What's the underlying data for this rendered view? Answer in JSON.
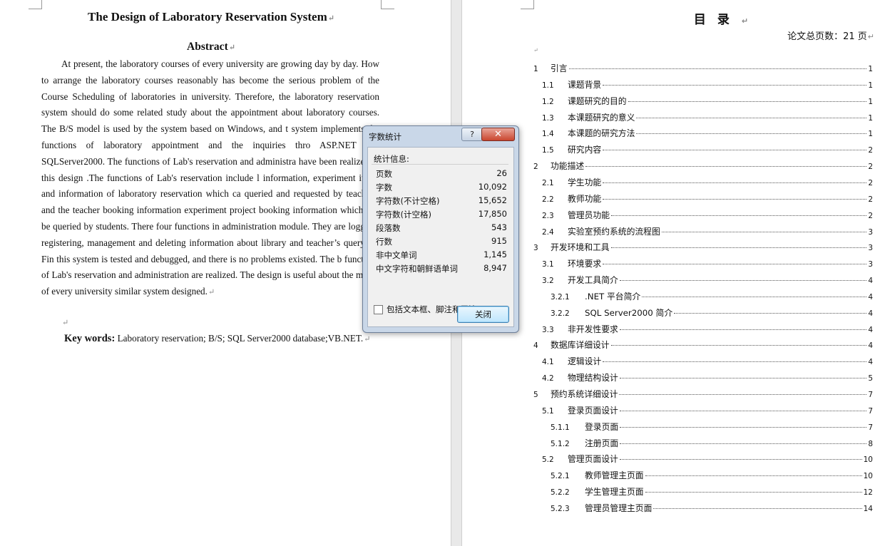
{
  "left_page": {
    "title": "The Design of Laboratory Reservation System",
    "abstract_heading": "Abstract",
    "abstract_lines": [
      "At present, the laboratory courses of every university are growing day by day.",
      "How to arrange the laboratory courses reasonably has become the serious problem of",
      "the Course Scheduling of laboratories in university. Therefore, the laboratory",
      "reservation system should do some related study about the appointment about",
      "laboratory courses. The B/S model is used by the system based on Windows, and t",
      "system implements the functions of laboratory appointment and the inquiries thro",
      "ASP.NET and SQLServer2000. The functions of Lab's reservation and administra",
      "have been realized in this design .The functions of Lab's reservation include l",
      "information, experiment items and information of laboratory reservation which ca",
      "queried and requested by teachers, and the teacher booking information",
      "experiment project booking information which can be queried by students. There",
      "four functions in administration module. They are logging, registering,",
      "management and deleting information about library and teacher’s querying. Fin",
      "this system is tested and debugged, and there is no problems existed. The b",
      "functions of Lab's reservation and administration are realized. The design is",
      "useful about the model of every university similar system designed."
    ],
    "keywords_label": "Key words:",
    "keywords_text": " Laboratory reservation; B/S; SQL Server2000 database;VB.NET."
  },
  "right_page": {
    "toc_title": "目录",
    "page_count": "论文总页数：21 页",
    "entries": [
      {
        "num": "1",
        "title": "引言",
        "page": "1"
      },
      {
        "num": "1.1",
        "title": "课题背景",
        "page": "1"
      },
      {
        "num": "1.2",
        "title": "课题研究的目的",
        "page": "1"
      },
      {
        "num": "1.3",
        "title": "本课题研究的意义",
        "page": "1"
      },
      {
        "num": "1.4",
        "title": "本课题的研究方法",
        "page": "1"
      },
      {
        "num": "1.5",
        "title": "研究内容",
        "page": "2"
      },
      {
        "num": "2",
        "title": "功能描述",
        "page": "2"
      },
      {
        "num": "2.1",
        "title": "学生功能",
        "page": "2"
      },
      {
        "num": "2.2",
        "title": "教师功能",
        "page": "2"
      },
      {
        "num": "2.3",
        "title": "管理员功能",
        "page": "2"
      },
      {
        "num": "2.4",
        "title": "实验室预约系统的流程图",
        "page": "3"
      },
      {
        "num": "3",
        "title": "开发环境和工具",
        "page": "3"
      },
      {
        "num": "3.1",
        "title": "环境要求",
        "page": "3"
      },
      {
        "num": "3.2",
        "title": "开发工具简介",
        "page": "4"
      },
      {
        "num": "3.2.1",
        "title": ".NET 平台简介",
        "page": "4"
      },
      {
        "num": "3.2.2",
        "title": "SQL Server2000 简介",
        "page": "4"
      },
      {
        "num": "3.3",
        "title": "非开发性要求",
        "page": "4"
      },
      {
        "num": "4",
        "title": "数据库详细设计",
        "page": "4"
      },
      {
        "num": "4.1",
        "title": "逻辑设计",
        "page": "4"
      },
      {
        "num": "4.2",
        "title": "物理结构设计",
        "page": "5"
      },
      {
        "num": "5",
        "title": "预约系统详细设计",
        "page": "7"
      },
      {
        "num": "5.1",
        "title": "登录页面设计",
        "page": "7"
      },
      {
        "num": "5.1.1",
        "title": "登录页面",
        "page": "7"
      },
      {
        "num": "5.1.2",
        "title": "注册页面",
        "page": "8"
      },
      {
        "num": "5.2",
        "title": "管理页面设计",
        "page": "10"
      },
      {
        "num": "5.2.1",
        "title": "教师管理主页面",
        "page": "10"
      },
      {
        "num": "5.2.2",
        "title": "学生管理主页面",
        "page": "12"
      },
      {
        "num": "5.2.3",
        "title": "管理员管理主页面",
        "page": "14"
      }
    ]
  },
  "dialog": {
    "title": "字数统计",
    "help_label": "?",
    "close_x_label": "✕",
    "stats_label": "统计信息:",
    "stats": [
      {
        "label": "页数",
        "value": "26"
      },
      {
        "label": "字数",
        "value": "10,092"
      },
      {
        "label": "字符数(不计空格)",
        "value": "15,652"
      },
      {
        "label": "字符数(计空格)",
        "value": "17,850"
      },
      {
        "label": "段落数",
        "value": "543"
      },
      {
        "label": "行数",
        "value": "915"
      },
      {
        "label": "非中文单词",
        "value": "1,145"
      },
      {
        "label": "中文字符和朝鲜语单词",
        "value": "8,947"
      }
    ],
    "checkbox_label": "包括文本框、脚注和尾注(F)",
    "checkbox_checked": false,
    "close_button_label": "关闭"
  }
}
